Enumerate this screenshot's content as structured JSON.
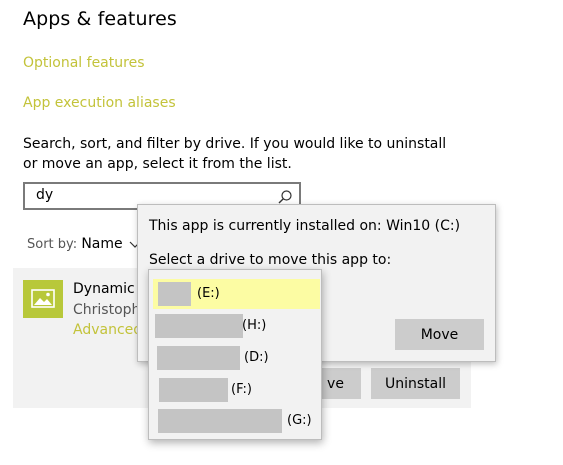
{
  "header": {
    "title": "Apps & features"
  },
  "links": {
    "optional_features": "Optional features",
    "app_execution_aliases": "App execution aliases"
  },
  "description": "Search, sort, and filter by drive. If you would like to uninstall or move an app, select it from the list.",
  "search": {
    "value": "dy",
    "icon": "search-icon"
  },
  "sort": {
    "label": "Sort by:",
    "value": "Name"
  },
  "app": {
    "name": "Dynamic T",
    "publisher": "Christoph",
    "advanced_link": "Advanced",
    "icon": "image-icon",
    "accent": "#b8c83a"
  },
  "buttons": {
    "uninstall": "Uninstall",
    "move_behind": "ve"
  },
  "flyout": {
    "installed_text": "This app is currently installed on: Win10 (C:)",
    "select_text": "Select a drive to move this app to:",
    "move_button": "Move"
  },
  "drives": [
    {
      "label": "(E:)",
      "selected": true
    },
    {
      "label": "(H:)",
      "selected": false
    },
    {
      "label": "(D:)",
      "selected": false
    },
    {
      "label": "(F:)",
      "selected": false
    },
    {
      "label": "(G:)",
      "selected": false
    }
  ],
  "colors": {
    "accent_link": "#c3c33a",
    "selected_option": "#fcfca3",
    "button": "#cccccc"
  }
}
